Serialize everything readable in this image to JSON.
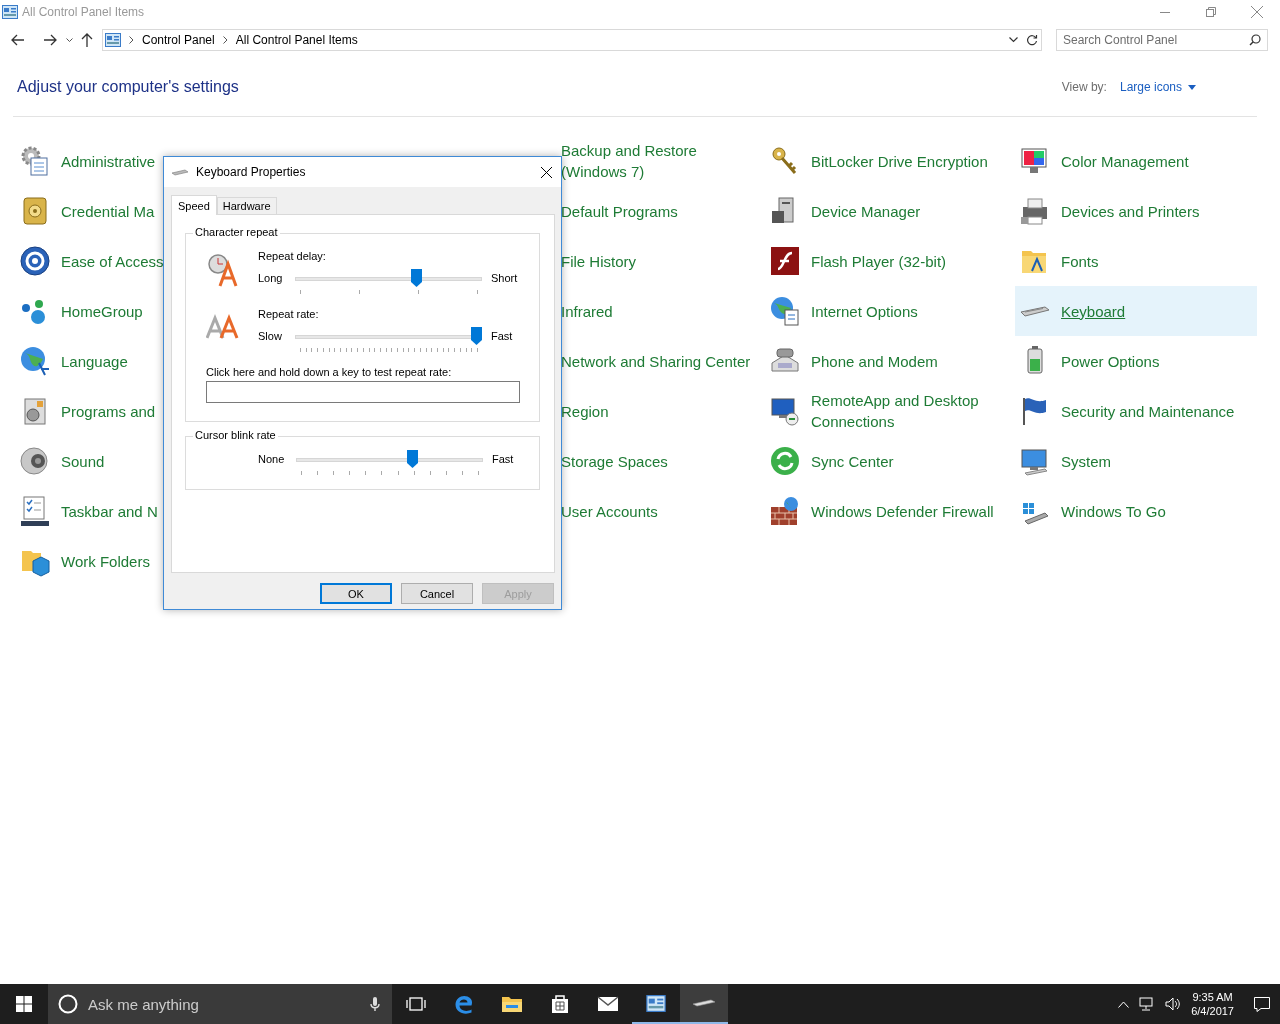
{
  "window": {
    "title": "All Control Panel Items"
  },
  "address_bar": {
    "breadcrumbs": [
      "Control Panel",
      "All Control Panel Items"
    ]
  },
  "search": {
    "placeholder": "Search Control Panel"
  },
  "heading": "Adjust your computer's settings",
  "view_by": {
    "label": "View by:",
    "value": "Large icons"
  },
  "columns": [
    [
      {
        "label": "Administrative",
        "selected": false
      },
      {
        "label": "Credential Ma",
        "selected": false
      },
      {
        "label": "Ease of Access",
        "selected": false
      },
      {
        "label": "HomeGroup",
        "selected": false
      },
      {
        "label": "Language",
        "selected": false
      },
      {
        "label": "Programs and",
        "selected": false
      },
      {
        "label": "Sound",
        "selected": false
      },
      {
        "label": "Taskbar and N",
        "selected": false
      },
      {
        "label": "Work Folders",
        "selected": false
      }
    ],
    [
      {
        "label": "Backup and Restore (Windows 7)",
        "selected": false
      },
      {
        "label": "Default Programs",
        "selected": false
      },
      {
        "label": "File History",
        "selected": false
      },
      {
        "label": "Infrared",
        "selected": false
      },
      {
        "label": "Network and Sharing Center",
        "selected": false
      },
      {
        "label": "Region",
        "selected": false
      },
      {
        "label": "Storage Spaces",
        "selected": false
      },
      {
        "label": "User Accounts",
        "selected": false
      }
    ],
    [
      {
        "label": "BitLocker Drive Encryption",
        "selected": false
      },
      {
        "label": "Device Manager",
        "selected": false
      },
      {
        "label": "Flash Player (32-bit)",
        "selected": false
      },
      {
        "label": "Internet Options",
        "selected": false
      },
      {
        "label": "Phone and Modem",
        "selected": false
      },
      {
        "label": "RemoteApp and Desktop Connections",
        "selected": false
      },
      {
        "label": "Sync Center",
        "selected": false
      },
      {
        "label": "Windows Defender Firewall",
        "selected": false
      }
    ],
    [
      {
        "label": "Color Management",
        "selected": false
      },
      {
        "label": "Devices and Printers",
        "selected": false
      },
      {
        "label": "Fonts",
        "selected": false
      },
      {
        "label": "Keyboard",
        "selected": true
      },
      {
        "label": "Power Options",
        "selected": false
      },
      {
        "label": "Security and Maintenance",
        "selected": false
      },
      {
        "label": "System",
        "selected": false
      },
      {
        "label": "Windows To Go",
        "selected": false
      }
    ]
  ],
  "dialog": {
    "title": "Keyboard Properties",
    "tabs": [
      {
        "label": "Speed",
        "selected": true
      },
      {
        "label": "Hardware",
        "selected": false
      }
    ],
    "groups": [
      {
        "title": "Character repeat",
        "sliders": [
          {
            "label": "Repeat delay:",
            "min_label": "Long",
            "max_label": "Short",
            "level": 0.66
          },
          {
            "label": "Repeat rate:",
            "min_label": "Slow",
            "max_label": "Fast",
            "level": 1
          }
        ],
        "test_field": {
          "label": "Click here and hold down a key to test repeat rate:"
        }
      },
      {
        "title": "Cursor blink rate",
        "sliders": [
          {
            "min_label": "None",
            "max_label": "Fast",
            "level": 0.63
          }
        ]
      }
    ],
    "buttons": [
      {
        "label": "OK",
        "default": true,
        "disabled": false
      },
      {
        "label": "Cancel",
        "default": false,
        "disabled": false
      },
      {
        "label": "Apply",
        "default": false,
        "disabled": true
      }
    ]
  },
  "taskbar": {
    "search": {
      "placeholder": "Ask me anything"
    },
    "apps": [
      {
        "running": false,
        "active": false
      },
      {
        "running": false,
        "active": false
      },
      {
        "running": false,
        "active": false
      },
      {
        "running": false,
        "active": false
      },
      {
        "running": false,
        "active": false
      },
      {
        "running": true,
        "active": false
      },
      {
        "running": true,
        "active": true
      }
    ],
    "clock": {
      "time": "9:35 AM",
      "date": "6/4/2017"
    }
  }
}
